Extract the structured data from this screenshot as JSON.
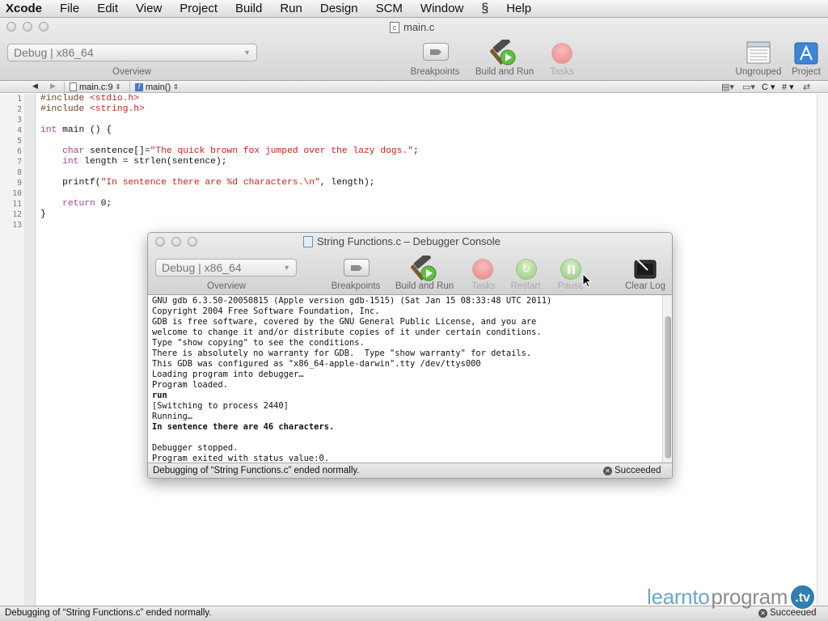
{
  "menu": {
    "app": "Xcode",
    "items": [
      "File",
      "Edit",
      "View",
      "Project",
      "Build",
      "Run",
      "Design",
      "SCM",
      "Window",
      "Help"
    ],
    "script_icon": "script-icon"
  },
  "main_window": {
    "title": "main.c",
    "file_type_badge": "c",
    "overview_popup_value": "Debug | x86_64",
    "overview_label": "Overview",
    "breakpoints_label": "Breakpoints",
    "build_and_run_label": "Build and Run",
    "tasks_label": "Tasks",
    "ungrouped_label": "Ungrouped",
    "project_label": "Project"
  },
  "navbar": {
    "file_popup": "main.c:9",
    "function_popup": "main()",
    "right_popup_c": "C",
    "right_popup_hash": "#"
  },
  "editor": {
    "line_numbers": [
      "1",
      "2",
      "3",
      "4",
      "5",
      "6",
      "7",
      "8",
      "9",
      "10",
      "11",
      "12",
      "13"
    ],
    "lines": [
      "#include <stdio.h>",
      "#include <string.h>",
      "",
      "int main () {",
      "",
      "    char sentence[]=\"The quick brown fox jumped over the lazy dogs.\";",
      "    int length = strlen(sentence);",
      "",
      "    printf(\"In sentence there are %d characters.\\n\", length);",
      "",
      "    return 0;",
      "}",
      ""
    ]
  },
  "console": {
    "title": "String Functions.c – Debugger Console",
    "overview_popup_value": "Debug | x86_64",
    "overview_label": "Overview",
    "breakpoints_label": "Breakpoints",
    "build_and_run_label": "Build and Run",
    "tasks_label": "Tasks",
    "restart_label": "Restart",
    "pause_label": "Pause",
    "clear_log_label": "Clear Log",
    "log": [
      {
        "text": "GNU gdb 6.3.50-20050815 (Apple version gdb-1515) (Sat Jan 15 08:33:48 UTC 2011)",
        "bold": false
      },
      {
        "text": "Copyright 2004 Free Software Foundation, Inc.",
        "bold": false
      },
      {
        "text": "GDB is free software, covered by the GNU General Public License, and you are",
        "bold": false
      },
      {
        "text": "welcome to change it and/or distribute copies of it under certain conditions.",
        "bold": false
      },
      {
        "text": "Type \"show copying\" to see the conditions.",
        "bold": false
      },
      {
        "text": "There is absolutely no warranty for GDB.  Type \"show warranty\" for details.",
        "bold": false
      },
      {
        "text": "This GDB was configured as \"x86_64-apple-darwin\".tty /dev/ttys000",
        "bold": false
      },
      {
        "text": "Loading program into debugger…",
        "bold": false
      },
      {
        "text": "Program loaded.",
        "bold": false
      },
      {
        "text": "run",
        "bold": true
      },
      {
        "text": "[Switching to process 2440]",
        "bold": false
      },
      {
        "text": "Running…",
        "bold": false
      },
      {
        "text": "In sentence there are 46 characters.",
        "bold": true
      },
      {
        "text": "",
        "bold": false
      },
      {
        "text": "Debugger stopped.",
        "bold": false
      },
      {
        "text": "Program exited with status value:0.",
        "bold": false
      }
    ],
    "status_text": "Debugging of “String Functions.c” ended normally.",
    "succeeded": "Succeeded"
  },
  "statusbar": {
    "text": "Debugging of “String Functions.c” ended normally.",
    "succeeded": "Succeeded"
  },
  "watermark": {
    "part1": "learnto",
    "part2": "program",
    "badge": ".tv"
  },
  "colors": {
    "keyword": "#a83d9b",
    "string": "#c4241b",
    "stop_button": "#ee6a6a",
    "go_button": "#7fc762",
    "watermark_blue": "#2f7fb0"
  }
}
